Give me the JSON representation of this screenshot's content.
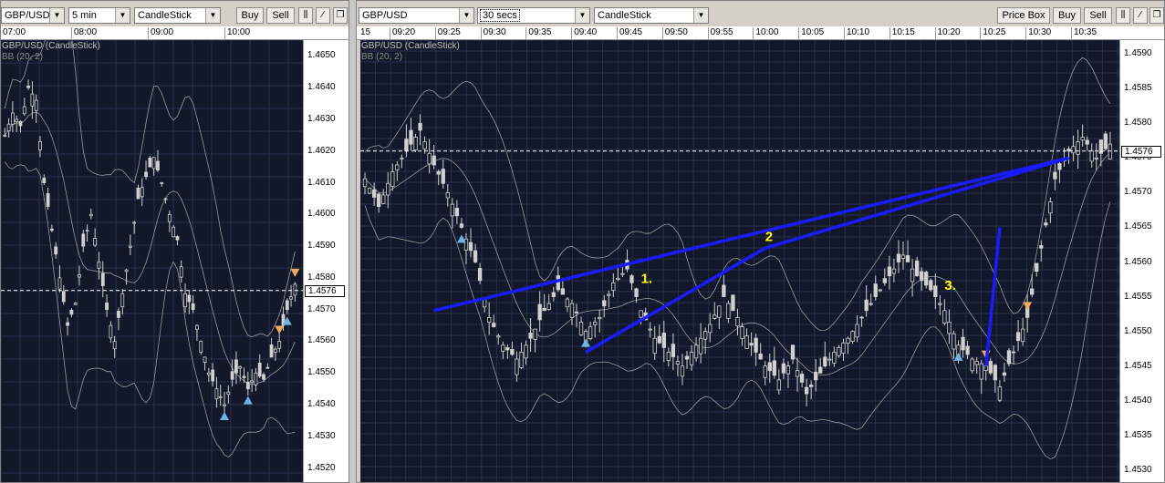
{
  "left": {
    "symbol": "GBP/USD",
    "interval": "5 min",
    "chart_type": "CandleStick",
    "buy_label": "Buy",
    "sell_label": "Sell",
    "times": [
      "07:00",
      "08:00",
      "09:00",
      "10:00"
    ],
    "legend_title": "GBP/USD (CandleStick)",
    "legend_bb": "BB (20, 2)",
    "prices": [
      "1.4650",
      "1.4640",
      "1.4630",
      "1.4620",
      "1.4610",
      "1.4600",
      "1.4590",
      "1.4580",
      "1.4570",
      "1.4560",
      "1.4550",
      "1.4540",
      "1.4530",
      "1.4520"
    ],
    "current_price": "1.4576"
  },
  "right": {
    "symbol": "GBP/USD",
    "interval": "30 secs",
    "chart_type": "CandleStick",
    "price_box_label": "Price Box",
    "buy_label": "Buy",
    "sell_label": "Sell",
    "times": [
      "15",
      "09:20",
      "09:25",
      "09:30",
      "09:35",
      "09:40",
      "09:45",
      "09:50",
      "09:55",
      "10:00",
      "10:05",
      "10:10",
      "10:15",
      "10:20",
      "10:25",
      "10:30",
      "10:35"
    ],
    "legend_title": "GBP/USD (CandleStick)",
    "legend_bb": "BB (20, 2)",
    "prices": [
      "1.4590",
      "1.4585",
      "1.4580",
      "1.4575",
      "1.4570",
      "1.4565",
      "1.4560",
      "1.4555",
      "1.4550",
      "1.4545",
      "1.4540",
      "1.4535",
      "1.4530"
    ],
    "current_price": "1.4576",
    "annotations": [
      "1.",
      "2",
      "3."
    ]
  },
  "colors": {
    "plot_bg": "#12182a",
    "grid": "#243049",
    "candle": "#d0d0d0",
    "band": "#b8b8b8",
    "buy_marker": "#6fb3e6",
    "sell_marker": "#f0a860",
    "drawn_line": "#1a1aff",
    "annotation": "#ffff00"
  },
  "icons": [
    "bar-chart-icon",
    "pencil-line-icon",
    "restore-window-icon"
  ],
  "chart_data": [
    {
      "type": "candlestick",
      "title": "GBP/USD (CandleStick)",
      "indicator": "BB (20, 2)",
      "interval": "5 min",
      "x_ticks": [
        "07:00",
        "08:00",
        "09:00",
        "10:00"
      ],
      "ylim": [
        1.4515,
        1.4655
      ],
      "current_price": 1.4576,
      "close": [
        1.4625,
        1.4632,
        1.4628,
        1.464,
        1.4636,
        1.461,
        1.4595,
        1.458,
        1.4565,
        1.4572,
        1.459,
        1.46,
        1.4585,
        1.457,
        1.456,
        1.4575,
        1.459,
        1.4605,
        1.4612,
        1.4618,
        1.461,
        1.46,
        1.4592,
        1.4575,
        1.457,
        1.456,
        1.455,
        1.4545,
        1.454,
        1.4548,
        1.4552,
        1.4545,
        1.455,
        1.4548,
        1.4555,
        1.456,
        1.457,
        1.4578
      ],
      "markers": [
        {
          "kind": "buy",
          "at": 28
        },
        {
          "kind": "buy",
          "at": 31
        },
        {
          "kind": "buy",
          "at": 36
        },
        {
          "kind": "sell",
          "at": 37
        },
        {
          "kind": "sell",
          "at": 35
        }
      ]
    },
    {
      "type": "candlestick",
      "title": "GBP/USD (CandleStick)",
      "indicator": "BB (20, 2)",
      "interval": "30 secs",
      "x_ticks": [
        "15",
        "09:20",
        "09:25",
        "09:30",
        "09:35",
        "09:40",
        "09:45",
        "09:50",
        "09:55",
        "10:00",
        "10:05",
        "10:10",
        "10:15",
        "10:20",
        "10:25",
        "10:30",
        "10:35"
      ],
      "ylim": [
        1.4528,
        1.4592
      ],
      "current_price": 1.4576,
      "close": [
        1.4572,
        1.4568,
        1.4573,
        1.4576,
        1.4579,
        1.4574,
        1.457,
        1.4565,
        1.456,
        1.4552,
        1.4548,
        1.4546,
        1.4549,
        1.4553,
        1.4556,
        1.4554,
        1.455,
        1.4552,
        1.4557,
        1.4559,
        1.4553,
        1.4549,
        1.4547,
        1.4545,
        1.4548,
        1.4551,
        1.4555,
        1.4552,
        1.4548,
        1.4545,
        1.4543,
        1.4546,
        1.4541,
        1.4544,
        1.4547,
        1.4549,
        1.4552,
        1.4555,
        1.4558,
        1.4561,
        1.4558,
        1.4556,
        1.4553,
        1.4548,
        1.4546,
        1.4545,
        1.4542,
        1.4547,
        1.4552,
        1.4562,
        1.4572,
        1.4576,
        1.4578,
        1.4575,
        1.4577
      ],
      "markers": [
        {
          "kind": "buy",
          "at": 7
        },
        {
          "kind": "buy",
          "at": 16
        },
        {
          "kind": "buy",
          "at": 43
        },
        {
          "kind": "sell",
          "at": 45
        },
        {
          "kind": "sell",
          "at": 48
        }
      ]
    }
  ]
}
